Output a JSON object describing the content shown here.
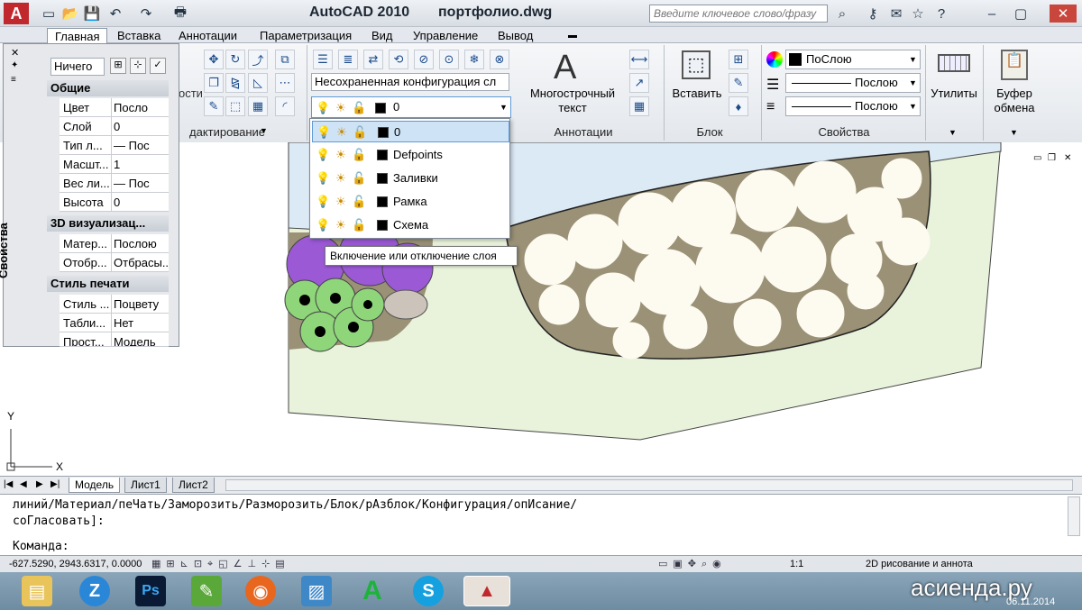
{
  "app": {
    "title": "AutoCAD 2010",
    "filename": "портфолио.dwg",
    "logo_letter": "A"
  },
  "search": {
    "placeholder": "Введите ключевое слово/фразу"
  },
  "ribbon_tabs": [
    "Главная",
    "Вставка",
    "Аннотации",
    "Параметризация",
    "Вид",
    "Управление",
    "Вывод"
  ],
  "ribbon": {
    "edit_group_fragment": "дактирование",
    "left_fragment": "ости",
    "layer_state": "Несохраненная конфигурация сл",
    "current_layer": "0",
    "multiline_text": "Многострочный\nтекст",
    "annotations_group": "Аннотации",
    "insert_label": "Вставить",
    "block_group": "Блок",
    "bylayer_color": "ПоСлою",
    "linetype": "Послою",
    "lineweight": "Послою",
    "properties_group": "Свойства",
    "utilities": "Утилиты",
    "clipboard": "Буфер\nобмена"
  },
  "layer_dropdown": {
    "items": [
      "0",
      "Defpoints",
      "Заливки",
      "Рамка",
      "Схема"
    ],
    "selected": "0"
  },
  "tooltip": "Включение или отключение слоя",
  "properties_palette": {
    "vertical_title": "Свойства",
    "selection": "Ничего",
    "sections": [
      {
        "title": "Общие",
        "rows": [
          [
            "Цвет",
            "Посло"
          ],
          [
            "Слой",
            "0"
          ],
          [
            "Тип л...",
            "— Пос"
          ],
          [
            "Масшт...",
            "1"
          ],
          [
            "Вес ли...",
            "— Пос"
          ],
          [
            "Высота",
            "0"
          ]
        ]
      },
      {
        "title": "3D визуализац...",
        "rows": [
          [
            "Матер...",
            "Послою"
          ],
          [
            "Отобр...",
            "Отбрасы..."
          ]
        ]
      },
      {
        "title": "Стиль печати",
        "rows": [
          [
            "Стиль ...",
            "Поцвету"
          ],
          [
            "Табли...",
            "Нет"
          ],
          [
            "Прост...",
            "Модель"
          ]
        ]
      }
    ]
  },
  "ucs": {
    "x": "X",
    "y": "Y"
  },
  "layout_tabs": [
    "Модель",
    "Лист1",
    "Лист2"
  ],
  "command": {
    "line1": "линий/Материал/пеЧать/Заморозить/Разморозить/Блок/рАзблок/Конфигурация/опИсание/",
    "line2": "соГласовать]:",
    "prompt": "Команда:"
  },
  "status": {
    "coords": "-627.5290, 2943.6317, 0.0000",
    "scale": "1:1",
    "workspace": "2D рисование и аннота"
  },
  "watermark": "асиенда.ру",
  "date": "06.11.2014",
  "taskbar_apps": [
    "explorer",
    "zoom",
    "photoshop",
    "notepad",
    "firefox",
    "image-viewer",
    "autocad-green",
    "skype",
    "autocad-2010"
  ],
  "colors": {
    "purple": "#9b59d6",
    "green": "#8fd67a",
    "olive": "#9a9176",
    "cream": "#fdfaf0",
    "lightgreen": "#e6f2d9",
    "water": "#dceaf6"
  }
}
